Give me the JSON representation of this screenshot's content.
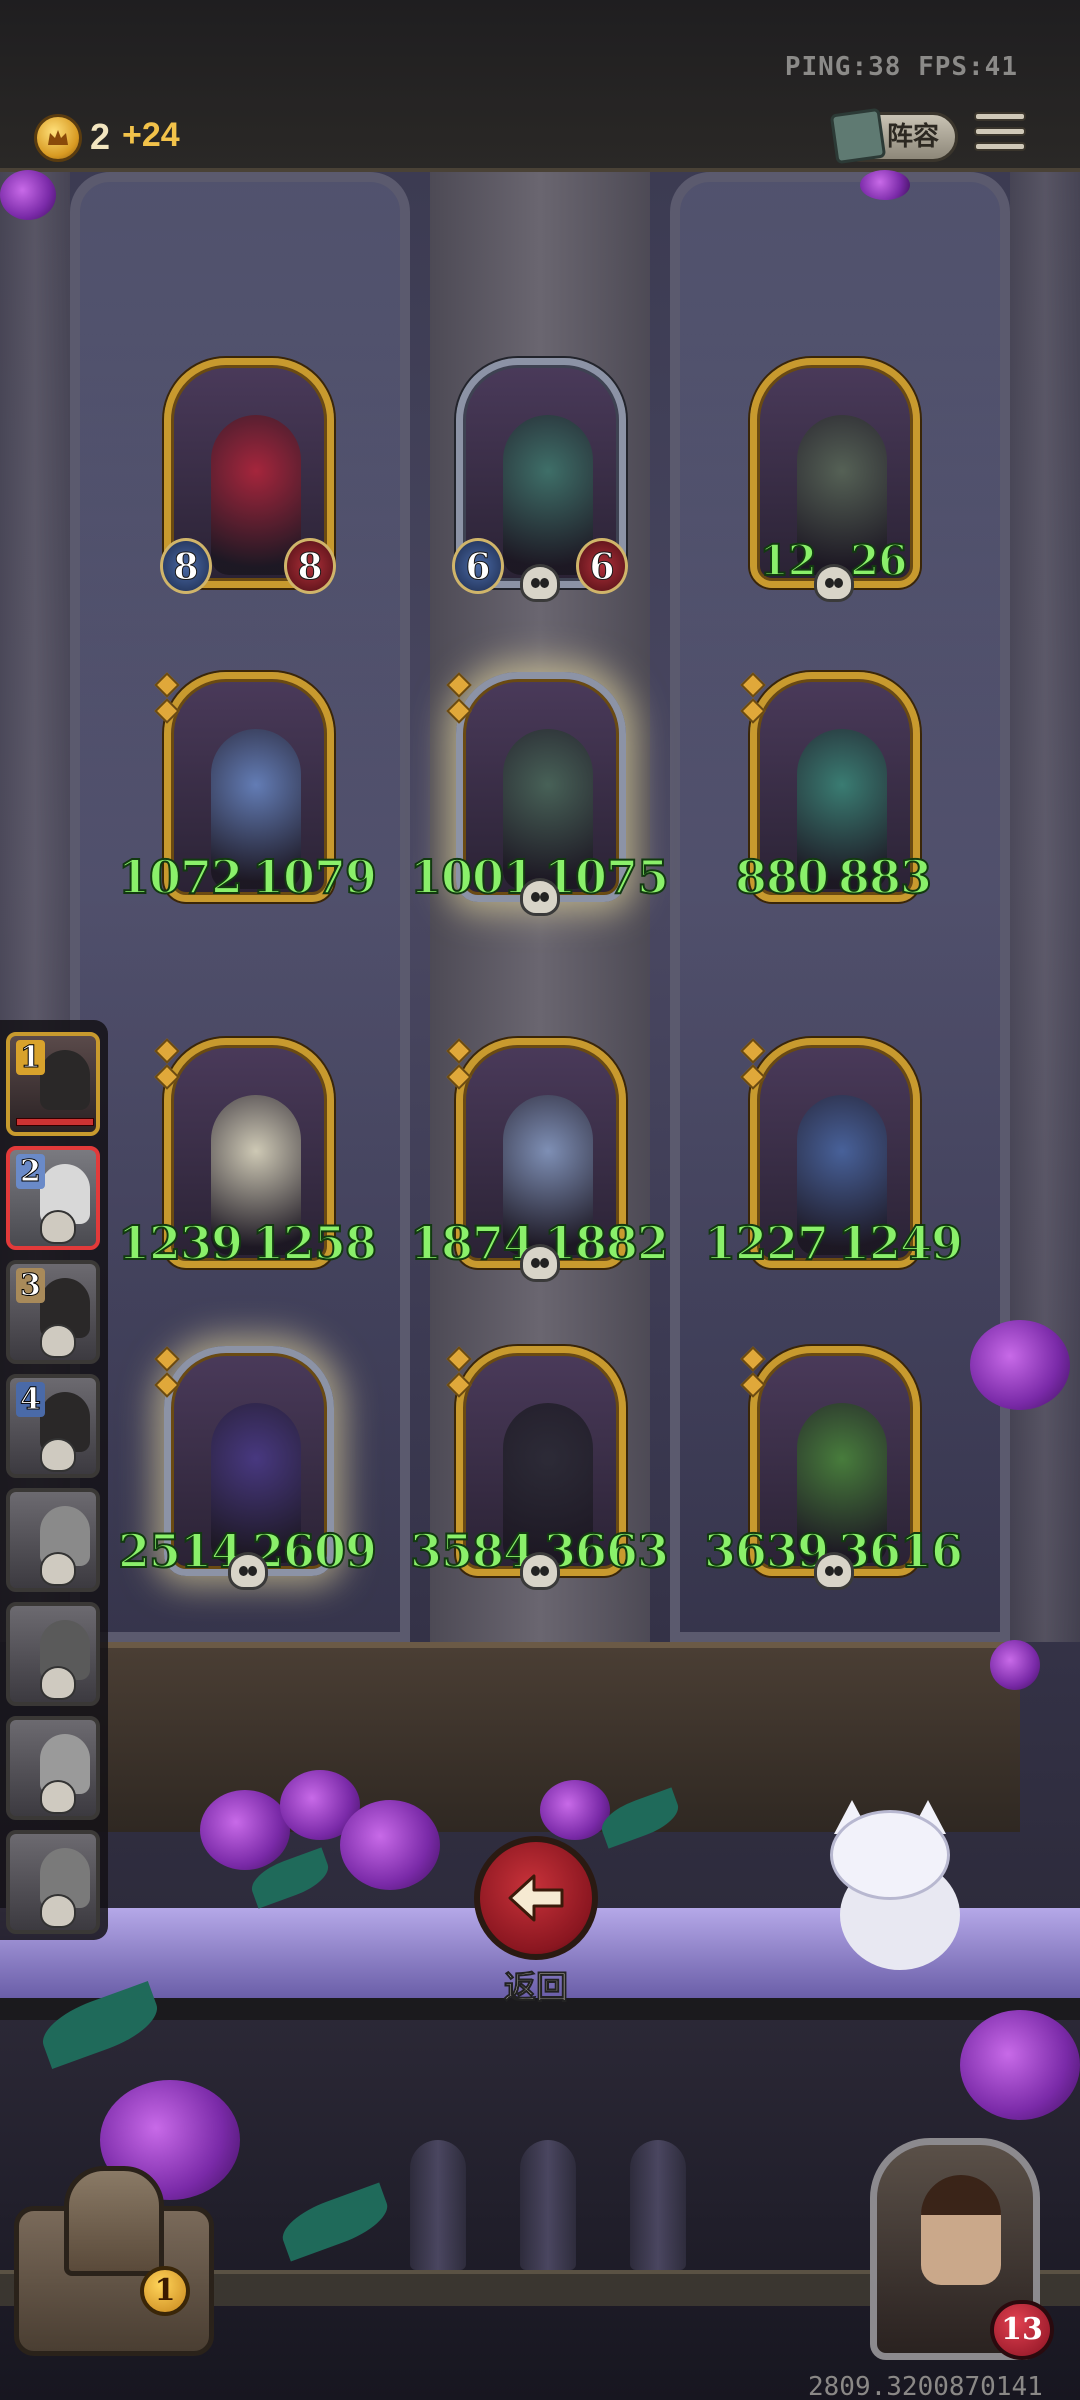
{
  "status": {
    "net": "PING:38   FPS:41"
  },
  "resources": {
    "gold": "2",
    "gold_income": "+24"
  },
  "header": {
    "lineup_label": "阵容"
  },
  "board": {
    "units": [
      {
        "atk": "8",
        "hp": "8",
        "style": "small",
        "frame": "gold",
        "color": "#b8243a"
      },
      {
        "atk": "6",
        "hp": "6",
        "style": "small",
        "frame": "silver",
        "color": "#3f7a6e"
      },
      {
        "atk": "12",
        "hp": "26",
        "style": "green-small",
        "frame": "gold",
        "color": "#5a6a58"
      },
      {
        "atk": "1072",
        "hp": "1079",
        "style": "big",
        "frame": "gold",
        "color": "#6a8ac8"
      },
      {
        "atk": "1001",
        "hp": "1075",
        "style": "big",
        "frame": "silver-glow",
        "color": "#4a6a5a"
      },
      {
        "atk": "880",
        "hp": "883",
        "style": "big",
        "frame": "gold",
        "color": "#3a8a7a"
      },
      {
        "atk": "1239",
        "hp": "1258",
        "style": "big",
        "frame": "gold",
        "color": "#e8e4c8"
      },
      {
        "atk": "1874",
        "hp": "1882",
        "style": "big",
        "frame": "gold",
        "color": "#8aa0c8"
      },
      {
        "atk": "1227",
        "hp": "1249",
        "style": "big",
        "frame": "gold",
        "color": "#4a6aa8"
      },
      {
        "atk": "2514",
        "hp": "2609",
        "style": "big",
        "frame": "silver-glow",
        "color": "#4a3a8a"
      },
      {
        "atk": "3584",
        "hp": "3663",
        "style": "big",
        "frame": "gold",
        "color": "#2a2a34"
      },
      {
        "atk": "3639",
        "hp": "3616",
        "style": "big",
        "frame": "gold",
        "color": "#4a8a3a"
      }
    ]
  },
  "roster": {
    "slots": [
      "1",
      "2",
      "3",
      "4"
    ]
  },
  "actions": {
    "back_label": "返回"
  },
  "chest": {
    "count": "1"
  },
  "hero": {
    "health": "13"
  },
  "footer": {
    "build_id": "2809.3200870141"
  }
}
